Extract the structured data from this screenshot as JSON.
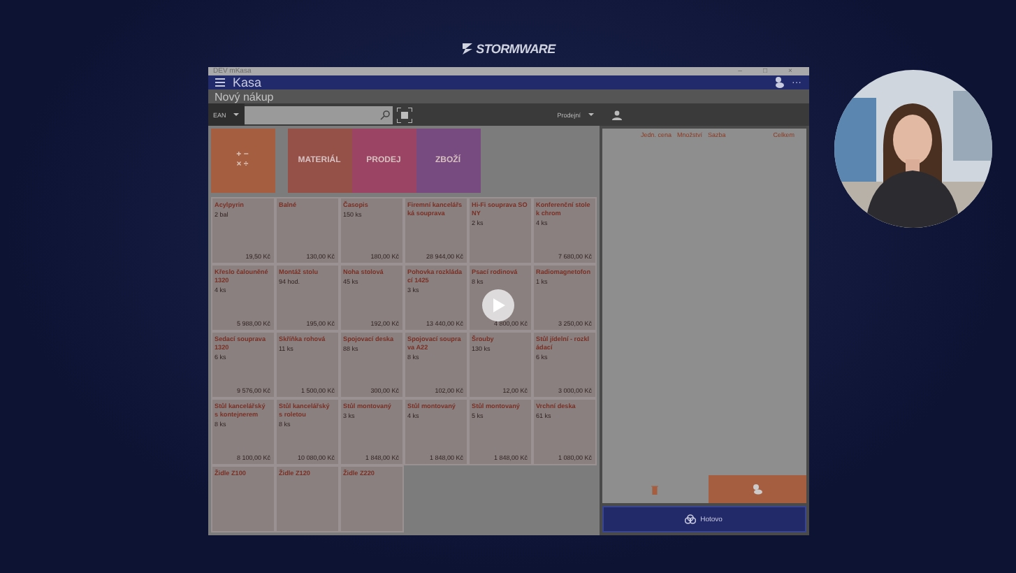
{
  "brand": {
    "name": "STORMWARE"
  },
  "window": {
    "title": "DEV mKasa",
    "controls": [
      "–",
      "□",
      "×"
    ],
    "header": {
      "title": "Kasa",
      "more": "···"
    },
    "section_title": "Nový nákup",
    "toolbar": {
      "code_type": "EAN",
      "price_list": "Prodejní"
    },
    "categories": [
      {
        "kind": "calculator",
        "symbols": [
          "+ −",
          "× ÷"
        ],
        "color": "#a65e40"
      },
      {
        "kind": "label",
        "label": "MATERIÁL",
        "color": "#955048"
      },
      {
        "kind": "label",
        "label": "PRODEJ",
        "color": "#9c4463"
      },
      {
        "kind": "label",
        "label": "ZBOŽÍ",
        "color": "#774a80"
      }
    ],
    "items": [
      {
        "name": "Acylpyrin",
        "quantity": "2 bal",
        "price": "19,50 Kč"
      },
      {
        "name": "Balné",
        "price": "130,00 Kč"
      },
      {
        "name": "Časopis",
        "quantity": "150 ks",
        "price": "180,00 Kč"
      },
      {
        "name": "Firemní kancelářská souprava",
        "price": "28 944,00 Kč"
      },
      {
        "name": "Hi-Fi souprava SONY",
        "quantity": "2 ks"
      },
      {
        "name": "Konferenční stolek chrom",
        "quantity": "4 ks",
        "price": "7 680,00 Kč"
      },
      {
        "name": "Křeslo čalouněné 1320",
        "quantity": "4 ks",
        "price": "5 988,00 Kč"
      },
      {
        "name": "Montáž stolu",
        "quantity": "94 hod.",
        "price": "195,00 Kč"
      },
      {
        "name": "Noha stolová",
        "quantity": "45 ks",
        "price": "192,00 Kč"
      },
      {
        "name": "Pohovka rozkládací 1425",
        "quantity": "3 ks",
        "price": "13 440,00 Kč"
      },
      {
        "name": "Psací rodinová",
        "quantity": "8 ks",
        "price": "4 800,00 Kč"
      },
      {
        "name": "Radiomagnetofon",
        "quantity": "1 ks",
        "price": "3 250,00 Kč"
      },
      {
        "name": "Sedací souprava 1320",
        "quantity": "6 ks",
        "price": "9 576,00 Kč"
      },
      {
        "name": "Skříňka rohová",
        "quantity": "11 ks",
        "price": "1 500,00 Kč"
      },
      {
        "name": "Spojovací deska",
        "quantity": "88 ks",
        "price": "300,00 Kč"
      },
      {
        "name": "Spojovací souprava A22",
        "quantity": "8 ks",
        "price": "102,00 Kč"
      },
      {
        "name": "Šrouby",
        "quantity": "130 ks",
        "price": "12,00 Kč"
      },
      {
        "name": "Stůl jídelní - rozkládací",
        "quantity": "6 ks",
        "price": "3 000,00 Kč"
      },
      {
        "name": "Stůl kancelářský s kontejnerem",
        "quantity": "8 ks",
        "price": "8 100,00 Kč"
      },
      {
        "name": "Stůl kancelářský s roletou",
        "quantity": "8 ks",
        "price": "10 080,00 Kč"
      },
      {
        "name": "Stůl montovaný",
        "quantity": "3 ks",
        "price": "1 848,00 Kč"
      },
      {
        "name": "Stůl montovaný",
        "quantity": "4 ks",
        "price": "1 848,00 Kč"
      },
      {
        "name": "Stůl montovaný",
        "quantity": "5 ks",
        "price": "1 848,00 Kč"
      },
      {
        "name": "Vrchní deska",
        "quantity": "61 ks",
        "price": "1 080,00 Kč"
      },
      {
        "name": "Židle Z100"
      },
      {
        "name": "Židle Z120"
      },
      {
        "name": "Židle Z220"
      }
    ],
    "cart": {
      "columns": [
        "Jedn. cena",
        "Množství",
        "Sazba",
        "Celkem"
      ],
      "done_button": "Hotovo"
    }
  }
}
